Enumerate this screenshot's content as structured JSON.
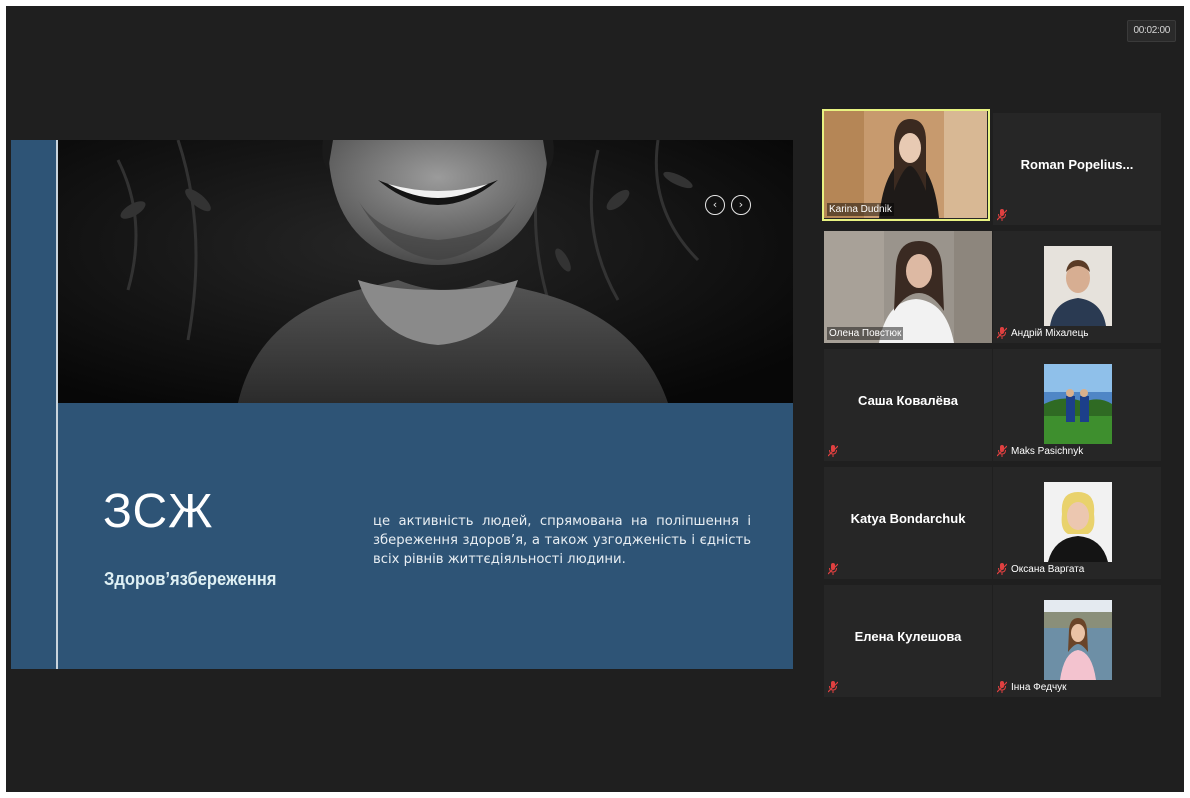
{
  "meeting": {
    "timer": "00:02:00"
  },
  "slide": {
    "title": "ЗСЖ",
    "subtitle": "Здоров’язбереження",
    "body": "це активність людей, спрямована на поліпшення і збереження здоров’я, а також узгодженість і єдність всіх рівнів життєдіяльності людини.",
    "prev_icon": "chevron-left-icon",
    "next_icon": "chevron-right-icon",
    "colors": {
      "panel": "#2e5476",
      "accent_text": "#dff0f4"
    }
  },
  "participants": [
    {
      "name": "Karina Dudnik",
      "video": true,
      "active": true
    },
    {
      "name": "Roman  Popelius...",
      "video": false
    },
    {
      "name": "Олена Повстюк",
      "video": true
    },
    {
      "name": "Андрій Міхалець",
      "video": false,
      "avatar": true
    },
    {
      "name": "Саша Ковалёва",
      "video": false
    },
    {
      "name": "Maks Pasichnyk",
      "video": false,
      "avatar": true
    },
    {
      "name": "Katya Bondarchuk",
      "video": false
    },
    {
      "name": "Оксана Варгата",
      "video": false,
      "avatar": true
    },
    {
      "name": "Елена Кулешова",
      "video": false
    },
    {
      "name": "Інна Федчук",
      "video": false,
      "avatar": true
    }
  ],
  "colors": {
    "background": "#1f1f1f",
    "tile": "#262626",
    "active_speaker_border": "#e8f281",
    "muted_icon": "#e04040"
  }
}
